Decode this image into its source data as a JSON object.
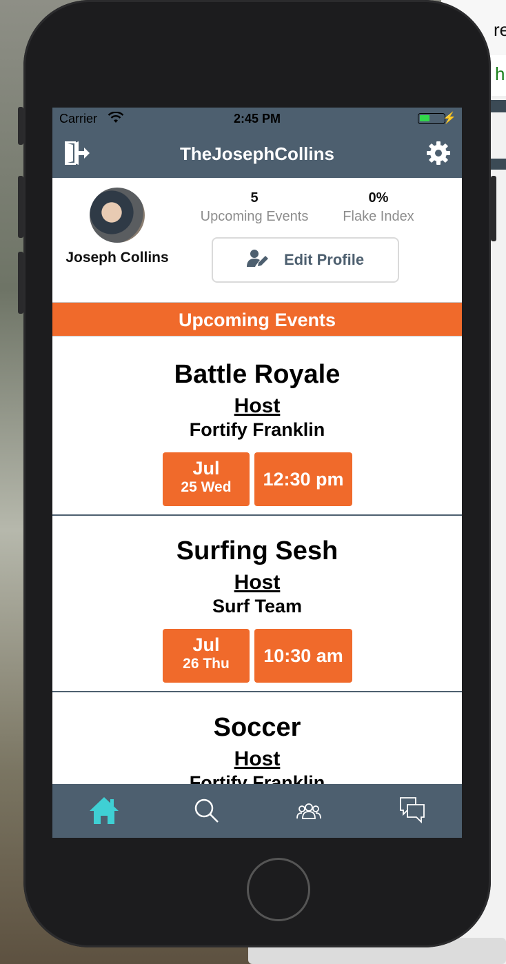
{
  "status_bar": {
    "carrier": "Carrier",
    "time": "2:45 PM"
  },
  "nav": {
    "title": "TheJosephCollins"
  },
  "profile": {
    "name": "Joseph Collins",
    "upcoming_events_count": "5",
    "upcoming_events_label": "Upcoming Events",
    "flake_index_value": "0%",
    "flake_index_label": "Flake Index",
    "edit_profile_label": "Edit Profile"
  },
  "section_header": "Upcoming Events",
  "events": [
    {
      "title": "Battle Royale",
      "role": "Host",
      "org": "Fortify Franklin",
      "month": "Jul",
      "day": "25 Wed",
      "time": "12:30 pm"
    },
    {
      "title": "Surfing Sesh",
      "role": "Host",
      "org": "Surf Team",
      "month": "Jul",
      "day": "26 Thu",
      "time": "10:30 am"
    },
    {
      "title": "Soccer",
      "role": "Host",
      "org": "Fortify Franklin",
      "month": "",
      "day": "",
      "time": ""
    }
  ],
  "tabs": [
    {
      "icon": "home-icon",
      "active": true
    },
    {
      "icon": "search-icon",
      "active": false
    },
    {
      "icon": "groups-icon",
      "active": false
    },
    {
      "icon": "chat-icon",
      "active": false
    }
  ],
  "colors": {
    "nav": "#4d5f6f",
    "accent": "#f06a2b",
    "active_tab": "#3fd0d4"
  },
  "background": {
    "partial_text_1": "re",
    "partial_text_2": "h"
  }
}
